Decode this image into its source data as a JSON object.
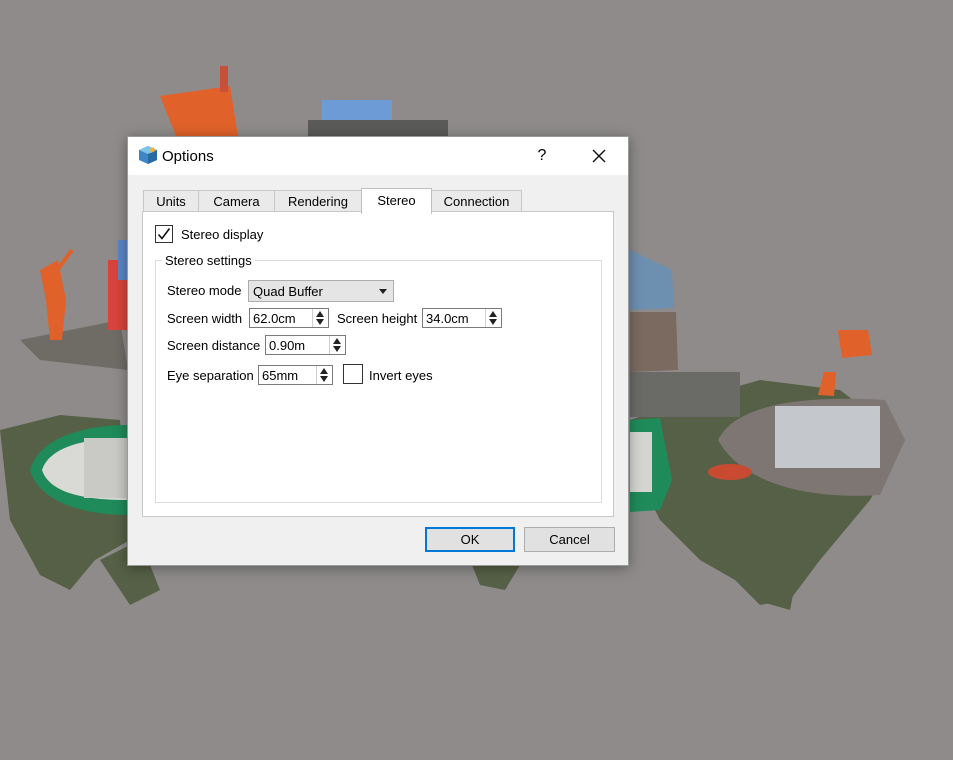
{
  "dialog": {
    "title": "Options",
    "help_label": "?",
    "tabs": [
      {
        "label": "Units"
      },
      {
        "label": "Camera"
      },
      {
        "label": "Rendering"
      },
      {
        "label": "Stereo"
      },
      {
        "label": "Connection"
      }
    ],
    "active_tab": "Stereo",
    "stereo": {
      "stereo_display_label": "Stereo display",
      "stereo_display_checked": true,
      "group_title": "Stereo settings",
      "stereo_mode_label": "Stereo mode",
      "stereo_mode_value": "Quad Buffer",
      "screen_width_label": "Screen width",
      "screen_width_value": "62.0cm",
      "screen_height_label": "Screen height",
      "screen_height_value": "34.0cm",
      "screen_distance_label": "Screen distance",
      "screen_distance_value": "0.90m",
      "eye_separation_label": "Eye separation",
      "eye_separation_value": "65mm",
      "invert_eyes_label": "Invert eyes",
      "invert_eyes_checked": false
    },
    "buttons": {
      "ok_label": "OK",
      "cancel_label": "Cancel"
    }
  },
  "colors": {
    "background": "#8e8b8a",
    "accent": "#0078d7",
    "crane_orange": "#e0622a",
    "ship_green": "#1f8a5a",
    "water": "#4f5a3e"
  }
}
